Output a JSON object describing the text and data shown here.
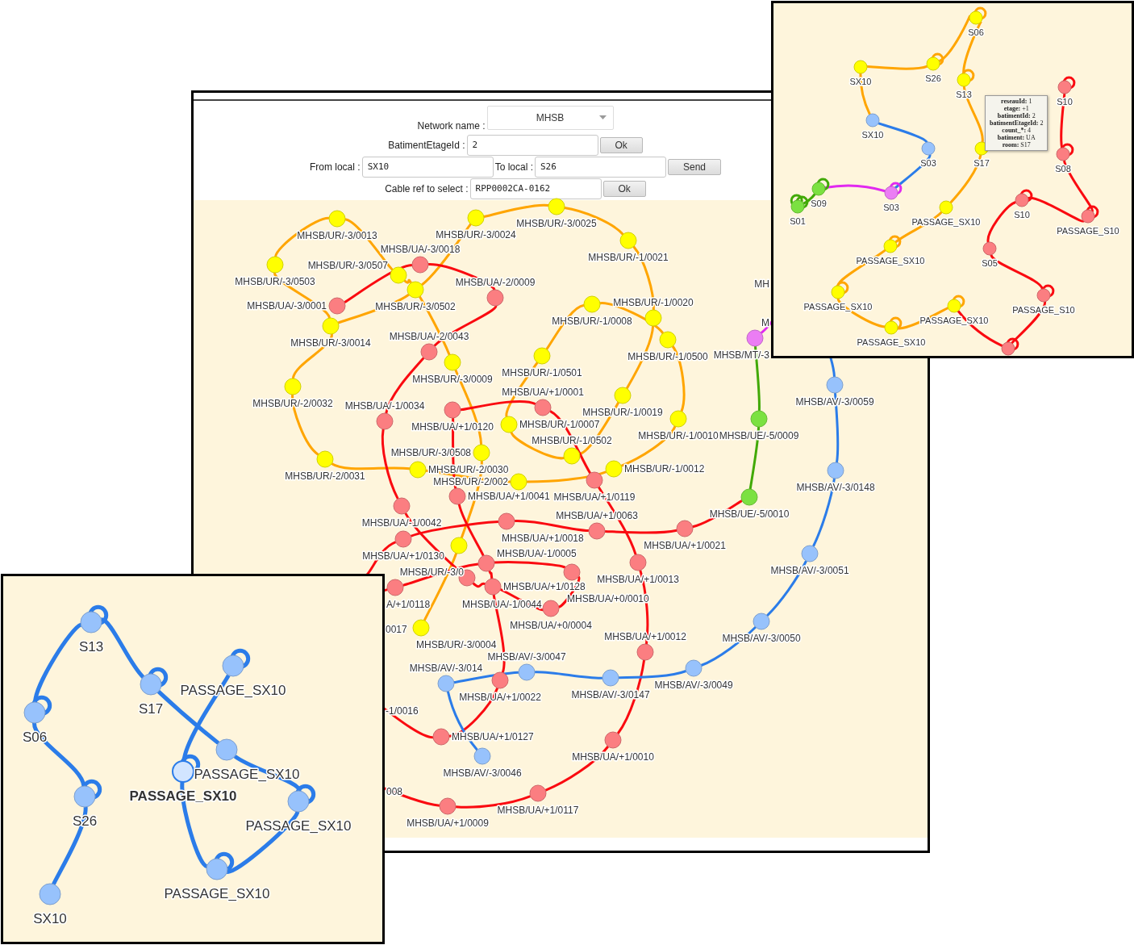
{
  "main_window": {
    "form": {
      "rows": [
        {
          "fields": [
            {
              "kind": "dropdown",
              "label": "Network name :",
              "value": "MHSB"
            }
          ]
        },
        {
          "fields": [
            {
              "kind": "input",
              "label": "BatimentEtageId :",
              "value": "2",
              "button": "Ok"
            }
          ]
        },
        {
          "fields": [
            {
              "kind": "input",
              "label": "From local :",
              "value": "SX10"
            },
            {
              "kind": "input",
              "label": "To local :",
              "value": "S26",
              "button": "Send"
            }
          ]
        },
        {
          "fields": [
            {
              "kind": "input",
              "label": "Cable ref to select :",
              "value": "RPP0002CA-0162",
              "button": "Ok"
            }
          ]
        }
      ]
    },
    "graph": {
      "nodes": [
        {
          "label": "MHSB/UR/-3/0025",
          "color": "#ffff00"
        },
        {
          "label": "MHSB/UR/-3/0013",
          "color": "#ffff00"
        },
        {
          "label": "MHSB/UR/-3/0024",
          "color": "#ffff00"
        },
        {
          "label": "MHSB/UA/-3/0018",
          "color": "#fb7e81"
        },
        {
          "label": "MHSB/UR/-3/0507",
          "color": "#ffff00"
        },
        {
          "label": "MHSB/UR/-1/0021",
          "color": "#ffff00"
        },
        {
          "label": "MHSB/UR/-3/0503",
          "color": "#ffff00"
        },
        {
          "label": "MHSB/UA/-2/0009",
          "color": "#fb7e81"
        },
        {
          "label": "MHSB/UA/-3/0001",
          "color": "#fb7e81"
        },
        {
          "label": "MHSB/UR/-3/0502",
          "color": "#ffff00"
        },
        {
          "label": "MHSB/UR/-1/0020",
          "color": "#ffff00"
        },
        {
          "label": "MHSB/UR/-1/0008",
          "color": "#ffff00"
        },
        {
          "label": "MHSB/UR/-3/0014",
          "color": "#ffff00"
        },
        {
          "label": "MHSB/UA/-2/0043",
          "color": "#fb7e81"
        },
        {
          "label": "MHSB/UR/-1/0500",
          "color": "#ffff00"
        },
        {
          "label": "MHSB/MT/-3",
          "color": "#eb7df4"
        },
        {
          "label": "MHSB/UR/-3/0009",
          "color": "#ffff00"
        },
        {
          "label": "MHSB/UR/-1/0501",
          "color": "#ffff00"
        },
        {
          "label": "MHSB/UA/+1/0001",
          "color": "#fb7e81"
        },
        {
          "label": "MHSB/UR/-2/0032",
          "color": "#ffff00"
        },
        {
          "label": "MHSB/UA/-1/0034",
          "color": "#fb7e81"
        },
        {
          "label": "MHSB/UR/-1/0019",
          "color": "#ffff00"
        },
        {
          "label": "MHSB/AV/-3/0059",
          "color": "#97c2fc"
        },
        {
          "label": "MHSB/UA/+1/0120",
          "color": "#fb7e81"
        },
        {
          "label": "MHSB/UR/-1/0007",
          "color": "#ffff00"
        },
        {
          "label": "MHSB/UR/-1/0502",
          "color": "#ffff00"
        },
        {
          "label": "MHSB/UR/-1/0010",
          "color": "#ffff00"
        },
        {
          "label": "MHSB/UE/-5/0009",
          "color": "#7be141"
        },
        {
          "label": "MHSB/UR/-3/0508",
          "color": "#ffff00"
        },
        {
          "label": "MHSB/UR/-2/0031",
          "color": "#ffff00"
        },
        {
          "label": "MHSB/UR/-2/0030",
          "color": "#ffff00"
        },
        {
          "label": "MHSB/UR/-1/0012",
          "color": "#ffff00"
        },
        {
          "label": "MHSB/UR/-2/002",
          "color": "#ffff00"
        },
        {
          "label": "MHSB/UA/+1/0041",
          "color": "#fb7e81"
        },
        {
          "label": "MHSB/UA/+1/0119",
          "color": "#fb7e81"
        },
        {
          "label": "MHSB/AV/-3/0148",
          "color": "#97c2fc"
        },
        {
          "label": "MHSB/UA/-1/0042",
          "color": "#fb7e81"
        },
        {
          "label": "MHSB/UA/+1/0063",
          "color": "#fb7e81"
        },
        {
          "label": "MHSB/UE/-5/0010",
          "color": "#7be141"
        },
        {
          "label": "MHSB/UA/+1/0018",
          "color": "#fb7e81"
        },
        {
          "label": "MHSB/UA/+1/0130",
          "color": "#fb7e81"
        },
        {
          "label": "MHSB/UA/-1/0005",
          "color": "#fb7e81"
        },
        {
          "label": "MHSB/UA/+1/0021",
          "color": "#fb7e81"
        },
        {
          "label": "MHSB/UR/-3/0",
          "color": "#ffff00"
        },
        {
          "label": "MHSB/AV/-3/0051",
          "color": "#97c2fc"
        },
        {
          "label": "MHSB/UA/+1/0128",
          "color": "#fb7e81"
        },
        {
          "label": "MHSB/UA/+1/0013",
          "color": "#fb7e81"
        },
        {
          "label": "A/+1/0118",
          "color": "#fb7e81"
        },
        {
          "label": "MHSB/UA/-1/0044",
          "color": "#fb7e81"
        },
        {
          "label": "MHSB/UA/+0/0010",
          "color": "#fb7e81"
        },
        {
          "label": "MHSB/UA/+0/0004",
          "color": "#fb7e81"
        },
        {
          "label": "MHSB/UR/-3/0004",
          "color": "#ffff00"
        },
        {
          "label": "MHSB/UA/+1/0012",
          "color": "#fb7e81"
        },
        {
          "label": "MHSB/AV/-3/0050",
          "color": "#97c2fc"
        },
        {
          "label": "MHSB/AV/-3/0047",
          "color": "#97c2fc"
        },
        {
          "label": "MHSB/AV/-3/014",
          "color": "#97c2fc"
        },
        {
          "label": "MHSB/AV/-3/0049",
          "color": "#97c2fc"
        },
        {
          "label": "MHSB/UA/+1/0022",
          "color": "#fb7e81"
        },
        {
          "label": "MHSB/AV/-3/0147",
          "color": "#97c2fc"
        },
        {
          "label": "MHSB/UA/+1/0127",
          "color": "#fb7e81"
        },
        {
          "label": "MHSB/UA/+1/0010",
          "color": "#fb7e81"
        },
        {
          "label": "MHSB/AV/-3/0046",
          "color": "#97c2fc"
        },
        {
          "label": "MHSB/UA/+1/0117",
          "color": "#fb7e81"
        },
        {
          "label": "MHSB/UA/+1/0009",
          "color": "#fb7e81"
        }
      ],
      "links": [
        {
          "kind": "path",
          "color": "#ffa500"
        },
        {
          "kind": "path",
          "color": "#ffa500"
        },
        {
          "kind": "path",
          "color": "#fa0a10"
        },
        {
          "kind": "path",
          "color": "#fa0a10"
        },
        {
          "kind": "path",
          "color": "#fa0a10"
        },
        {
          "kind": "path",
          "color": "#fa0a10"
        },
        {
          "kind": "path",
          "color": "#2b7ce9"
        },
        {
          "kind": "path",
          "color": "#2b7ce9"
        },
        {
          "kind": "path",
          "color": "#41a906"
        },
        {
          "kind": "path",
          "color": "#e129f0"
        }
      ],
      "cut_labels": [
        "MH",
        "M",
        "0017",
        "-1/0016",
        "008"
      ]
    }
  },
  "inset_windows": [
    {
      "graph": {
        "nodes": [
          {
            "label": "S06",
            "color": "#ffff00"
          },
          {
            "label": "SX10",
            "color": "#ffff00"
          },
          {
            "label": "S26",
            "color": "#ffff00"
          },
          {
            "label": "S13",
            "color": "#ffff00"
          },
          {
            "label": "S10",
            "color": "#fb7e81"
          },
          {
            "label": "SX10",
            "color": "#97c2fc"
          },
          {
            "label": "S03",
            "color": "#97c2fc"
          },
          {
            "label": "S17",
            "color": "#ffff00"
          },
          {
            "label": "S08",
            "color": "#fb7e81"
          },
          {
            "label": "S09",
            "color": "#7be141"
          },
          {
            "label": "S03",
            "color": "#eb7df4"
          },
          {
            "label": "S01",
            "color": "#7be141"
          },
          {
            "label": "PASSAGE_SX10",
            "color": "#ffff00"
          },
          {
            "label": "S10",
            "color": "#fb7e81"
          },
          {
            "label": "PASSAGE_S10",
            "color": "#fb7e81"
          },
          {
            "label": "PASSAGE_SX10",
            "color": "#ffff00"
          },
          {
            "label": "S05",
            "color": "#fb7e81"
          },
          {
            "label": "PASSAGE_SX10",
            "color": "#ffff00"
          },
          {
            "label": "PASSAGE_S10",
            "color": "#fb7e81"
          },
          {
            "label": "PASSAGE_SX10",
            "color": "#ffff00"
          },
          {
            "label": "PASSAGE_SX10",
            "color": "#ffff00"
          },
          {
            "color": "#fb7e81"
          }
        ],
        "links": [
          {
            "kind": "path",
            "color": "#ffa500"
          },
          {
            "kind": "path",
            "color": "#ffa500"
          },
          {
            "kind": "path",
            "color": "#2b7ce9"
          },
          {
            "kind": "path",
            "color": "#e129f0"
          },
          {
            "kind": "path",
            "color": "#41a906"
          },
          {
            "kind": "path",
            "color": "#fa0a10"
          },
          {
            "kind": "path",
            "color": "#fa0a10"
          },
          {
            "kind": "loop",
            "color": "#ffa500"
          },
          {
            "kind": "loop",
            "color": "#ffa500"
          },
          {
            "kind": "loop",
            "color": "#ffa500"
          },
          {
            "kind": "loop",
            "color": "#ffa500"
          },
          {
            "kind": "loop",
            "color": "#ffa500"
          },
          {
            "kind": "loop",
            "color": "#ffa500"
          },
          {
            "kind": "loop",
            "color": "#ffa500"
          },
          {
            "kind": "loop",
            "color": "#e129f0"
          },
          {
            "kind": "loop",
            "color": "#41a906"
          },
          {
            "kind": "loop",
            "color": "#41a906"
          },
          {
            "kind": "loop",
            "color": "#41a906"
          },
          {
            "kind": "loop",
            "color": "#fa0a10"
          },
          {
            "kind": "loop",
            "color": "#fa0a10"
          },
          {
            "kind": "loop",
            "color": "#fa0a10"
          },
          {
            "kind": "loop",
            "color": "#fa0a10"
          },
          {
            "kind": "loop",
            "color": "#fa0a10"
          },
          {
            "kind": "loop",
            "color": "#fa0a10"
          }
        ]
      },
      "tooltip": {
        "lines": [
          {
            "key": "reseauId:",
            "value": "1"
          },
          {
            "key": "etage:",
            "value": "+1"
          },
          {
            "key": "batimentId:",
            "value": "2"
          },
          {
            "key": "batimentEtageId:",
            "value": "2"
          },
          {
            "key": "count_*:",
            "value": "4"
          },
          {
            "key": "batiment:",
            "value": "UA"
          },
          {
            "key": "room:",
            "value": "S17"
          }
        ]
      }
    },
    {
      "graph": {
        "nodes": [
          {
            "label": "S13",
            "color": "#97c2fc",
            "selected": false
          },
          {
            "label": "PASSAGE_SX10",
            "color": "#97c2fc",
            "selected": false
          },
          {
            "label": "S17",
            "color": "#97c2fc",
            "selected": false
          },
          {
            "label": "S06",
            "color": "#97c2fc",
            "selected": false
          },
          {
            "label": "PASSAGE_SX10",
            "color": "#97c2fc",
            "selected": false
          },
          {
            "label": "PASSAGE_SX10",
            "color": "#d2e5ff",
            "selected": true
          },
          {
            "label": "S26",
            "color": "#97c2fc",
            "selected": false
          },
          {
            "label": "PASSAGE_SX10",
            "color": "#97c2fc",
            "selected": false
          },
          {
            "label": "PASSAGE_SX10",
            "color": "#97c2fc",
            "selected": false
          },
          {
            "label": "SX10",
            "color": "#97c2fc",
            "selected": false
          }
        ],
        "links": [
          {
            "kind": "path",
            "color": "#2b7ce9"
          },
          {
            "kind": "loop",
            "color": "#2b7ce9"
          },
          {
            "kind": "loop",
            "color": "#2b7ce9"
          },
          {
            "kind": "loop",
            "color": "#2b7ce9"
          },
          {
            "kind": "loop",
            "color": "#2b7ce9"
          },
          {
            "kind": "loop",
            "color": "#2b7ce9"
          },
          {
            "kind": "loop",
            "color": "#2b7ce9"
          },
          {
            "kind": "loop",
            "color": "#2b7ce9"
          },
          {
            "kind": "loop",
            "color": "#2b7ce9"
          }
        ]
      }
    }
  ]
}
